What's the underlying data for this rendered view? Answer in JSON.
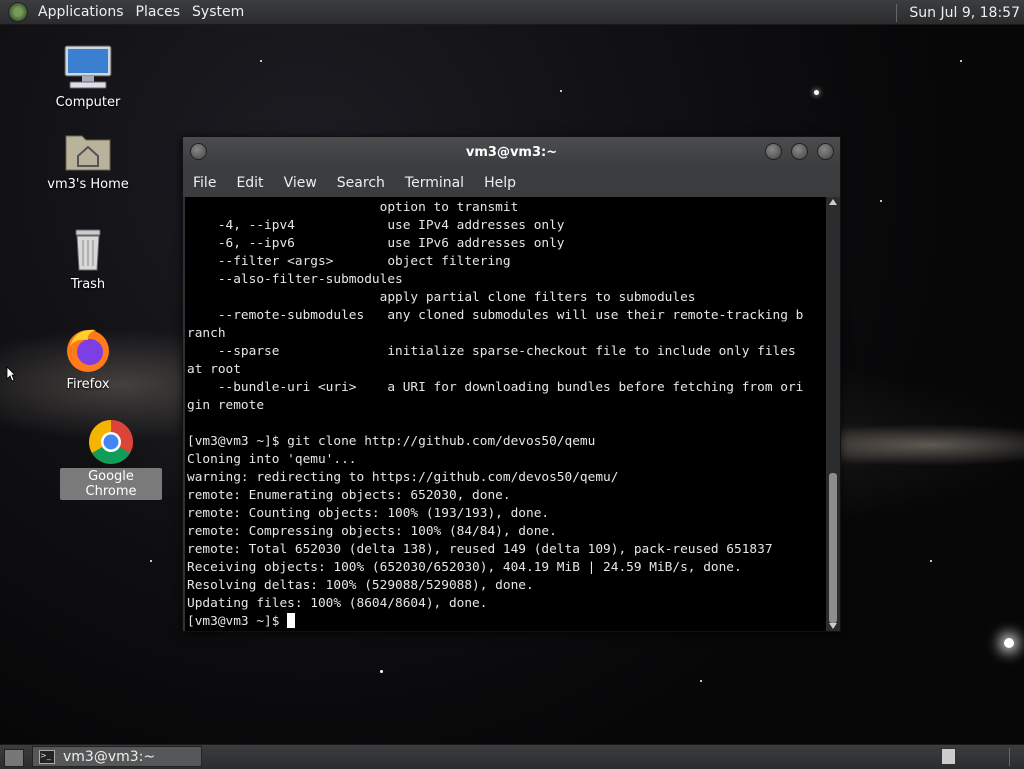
{
  "top_panel": {
    "menus": [
      "Applications",
      "Places",
      "System"
    ],
    "clock": "Sun Jul  9, 18:57"
  },
  "desktop_icons": [
    {
      "label": "Computer",
      "icon": "computer-icon"
    },
    {
      "label": "vm3's Home",
      "icon": "home-folder-icon"
    },
    {
      "label": "Trash",
      "icon": "trash-icon"
    },
    {
      "label": "Firefox",
      "icon": "firefox-icon"
    },
    {
      "label": "Google Chrome",
      "icon": "chrome-icon",
      "selected": true
    }
  ],
  "terminal": {
    "title": "vm3@vm3:~",
    "menu": [
      "File",
      "Edit",
      "View",
      "Search",
      "Terminal",
      "Help"
    ],
    "lines": [
      "                         option to transmit",
      "    -4, --ipv4            use IPv4 addresses only",
      "    -6, --ipv6            use IPv6 addresses only",
      "    --filter <args>       object filtering",
      "    --also-filter-submodules",
      "                         apply partial clone filters to submodules",
      "    --remote-submodules   any cloned submodules will use their remote-tracking b",
      "ranch",
      "    --sparse              initialize sparse-checkout file to include only files",
      "at root",
      "    --bundle-uri <uri>    a URI for downloading bundles before fetching from ori",
      "gin remote",
      "",
      "[vm3@vm3 ~]$ git clone http://github.com/devos50/qemu",
      "Cloning into 'qemu'...",
      "warning: redirecting to https://github.com/devos50/qemu/",
      "remote: Enumerating objects: 652030, done.",
      "remote: Counting objects: 100% (193/193), done.",
      "remote: Compressing objects: 100% (84/84), done.",
      "remote: Total 652030 (delta 138), reused 149 (delta 109), pack-reused 651837",
      "Receiving objects: 100% (652030/652030), 404.19 MiB | 24.59 MiB/s, done.",
      "Resolving deltas: 100% (529088/529088), done.",
      "Updating files: 100% (8604/8604), done."
    ],
    "prompt": "[vm3@vm3 ~]$ "
  },
  "bottom_panel": {
    "task_label": "vm3@vm3:~"
  },
  "colors": {
    "panel": "#2f3133",
    "console_bg": "#000000",
    "console_fg": "#e6e6e6"
  }
}
